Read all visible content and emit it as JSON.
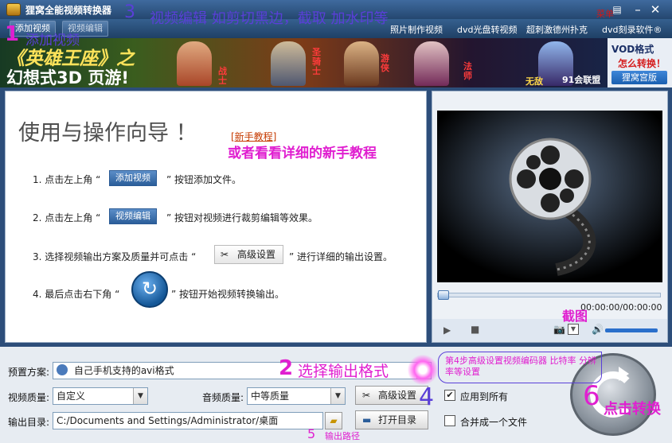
{
  "window": {
    "title": "狸窝全能视频转换器",
    "menu_label": "菜单"
  },
  "toolbar": {
    "add_video": "添加视频",
    "edit_video": "视频编辑",
    "links": [
      "照片制作视频",
      "dvd光盘转视频",
      "超刺激德州扑克",
      "dvd刻录软件®"
    ]
  },
  "banner": {
    "title_top": "《英雄王座》之",
    "title_bottom": "幻想式3D 页游!",
    "char_labels": [
      "战士",
      "圣骑士",
      "游侠",
      "法师",
      "无敌"
    ],
    "union": "91会联盟",
    "vod_title": "VOD格式",
    "vod_sub": "怎么转换！",
    "vod_btn": "狸窝宫版"
  },
  "guide": {
    "title": "使用与操作向导 ！",
    "newbie_link": "[新手教程]",
    "step1_pre": "1. 点击左上角 “",
    "step1_btn": "添加视频",
    "step1_post": "” 按钮添加文件。",
    "step2_pre": "2. 点击左上角 “",
    "step2_btn": "视频编辑",
    "step2_post": "” 按钮对视频进行裁剪编辑等效果。",
    "step3_pre": "3. 选择视频输出方案及质量并可点击 “",
    "step3_btn": "高级设置",
    "step3_post": "” 进行详细的输出设置。",
    "step4_pre": "4. 最后点击右下角 “",
    "step4_post": "” 按钮开始视频转换输出。"
  },
  "preview": {
    "time": "00:00:00/00:00:00"
  },
  "bottom": {
    "preset_label": "预置方案:",
    "preset_value": "自己手机支持的avi格式",
    "vq_label": "视频质量:",
    "vq_value": "自定义",
    "aq_label": "音频质量:",
    "aq_value": "中等质量",
    "adv_btn": "高级设置",
    "apply_all": "应用到所有",
    "apply_all_checked": true,
    "out_label": "输出目录:",
    "out_path": "C:/Documents and Settings/Administrator/桌面",
    "open_dir": "打开目录",
    "merge": "合并成一个文件",
    "merge_checked": false
  },
  "annotations": {
    "n1": "1",
    "a1": "添加视频",
    "n3": "3",
    "a3": "视频编辑  如剪切黑边，截取  加水印等",
    "newbie_hint": "或者看看详细的新手教程",
    "screenshot_hint": "截图",
    "n2": "2",
    "a2": "选择输出格式",
    "step4_note": "第4步高级设置视频编码器  比特率  分辨率等设置",
    "n4": "4",
    "n5": "5",
    "a5": "输出路径",
    "n6": "6",
    "a6": "点击转换"
  },
  "colors": {
    "annotation_blue": "#5a3fd8",
    "annotation_magenta": "#e01fd0",
    "window_frame": "#2d4e7a"
  }
}
